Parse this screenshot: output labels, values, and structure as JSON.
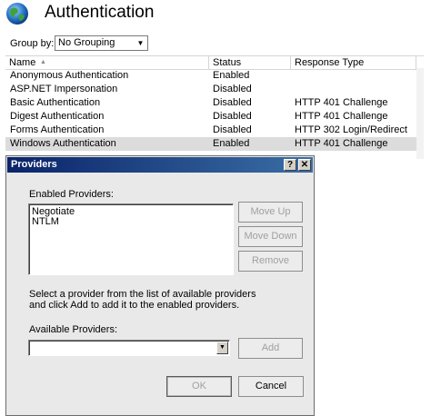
{
  "header": {
    "title": "Authentication"
  },
  "toolbar": {
    "group_by_label": "Group by:",
    "group_by_value": "No Grouping"
  },
  "list": {
    "columns": [
      "Name",
      "Status",
      "Response Type"
    ],
    "rows": [
      {
        "name": "Anonymous Authentication",
        "status": "Enabled",
        "response": ""
      },
      {
        "name": "ASP.NET Impersonation",
        "status": "Disabled",
        "response": ""
      },
      {
        "name": "Basic Authentication",
        "status": "Disabled",
        "response": "HTTP 401 Challenge"
      },
      {
        "name": "Digest Authentication",
        "status": "Disabled",
        "response": "HTTP 401 Challenge"
      },
      {
        "name": "Forms Authentication",
        "status": "Disabled",
        "response": "HTTP 302 Login/Redirect"
      },
      {
        "name": "Windows Authentication",
        "status": "Enabled",
        "response": "HTTP 401 Challenge"
      }
    ],
    "selected_row": 5
  },
  "dialog": {
    "title": "Providers",
    "help_button": "?",
    "close_button": "✕",
    "enabled_label": "Enabled Providers:",
    "enabled_items": [
      "Negotiate",
      "NTLM"
    ],
    "move_up": "Move Up",
    "move_down": "Move Down",
    "remove": "Remove",
    "instructions_line1": "Select a provider from the list of available providers",
    "instructions_line2": "and click Add to add it to the enabled providers.",
    "available_label": "Available Providers:",
    "available_value": "",
    "add": "Add",
    "ok": "OK",
    "cancel": "Cancel"
  },
  "colors": {
    "title_bar_start": "#0a246a",
    "title_bar_end": "#3a6ea5",
    "selected_row": "#dcdcdc",
    "dialog_face": "#e9e9e9"
  }
}
